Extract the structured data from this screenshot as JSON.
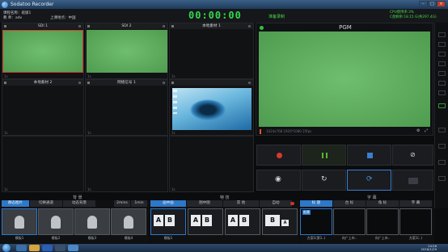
{
  "window": {
    "title": "Sodatoo Recorder",
    "min_label": "–",
    "max_label": "□",
    "close_label": "×"
  },
  "info": {
    "course_label": "课程名称：",
    "course_value": "班级1",
    "teacher_label": "教  师：",
    "teacher_value": "adv",
    "location_label": "上课地点：",
    "location_value": "中国",
    "clock": "00:00:00",
    "status": "准备录制",
    "cpu": "CPU使用率:3%",
    "disk": "C盘剩余:18.15 G(共297.4G)"
  },
  "cells": [
    {
      "title": "SDI 1",
      "foot": "1s"
    },
    {
      "title": "SDI 2",
      "foot": "1s"
    },
    {
      "title": "本地素材 1",
      "foot": "1s"
    },
    {
      "title": "本地素材 2",
      "foot": "1s"
    },
    {
      "title": "网络信号 1",
      "foot": "1s"
    },
    {
      "title": "",
      "foot": "1s"
    },
    {
      "title": "",
      "foot": "1s"
    },
    {
      "title": "",
      "foot": "1s"
    },
    {
      "title": "",
      "foot": "1s"
    }
  ],
  "pgm": {
    "title": "PGM",
    "info_text": "1024x768 1920*1080 25fps"
  },
  "sections": {
    "left": "背 景",
    "mid": "特 技",
    "right": "字 幕"
  },
  "bottom_left": {
    "tabs": [
      "静态图片",
      "切换通道",
      "动态背景",
      "2mins",
      "1min"
    ],
    "thumbs": [
      "模板1",
      "模板2",
      "模板3",
      "模板4"
    ]
  },
  "bottom_mid": {
    "tabs": [
      "画中画",
      "图中图",
      "其 他",
      "自动"
    ],
    "thumbs": [
      "模板1",
      "",
      "",
      ""
    ]
  },
  "bottom_right": {
    "tabs": [
      "标 题",
      "台 标",
      "角 标",
      "字 幕"
    ],
    "thumbs": [
      "前景",
      "",
      "",
      ""
    ],
    "foot": [
      "方案1(第1..)",
      "向广上市..",
      "向广上市..",
      "方案1(..)"
    ]
  },
  "taskbar": {
    "time": "14:26",
    "date": "2018/1/29"
  },
  "colors": {
    "accent": "#2d78c8",
    "clock": "#36d64c",
    "green_screen": "#5aab5a"
  }
}
